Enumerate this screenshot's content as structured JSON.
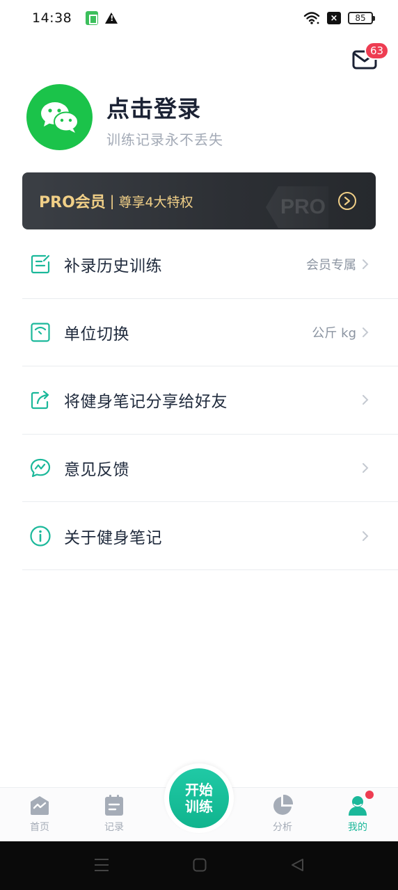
{
  "status_bar": {
    "time": "14:38",
    "battery": "85"
  },
  "mail": {
    "badge_count": "63"
  },
  "profile": {
    "title": "点击登录",
    "subtitle": "训练记录永不丢失"
  },
  "pro_banner": {
    "label": "PRO会员",
    "separator": "|",
    "perks": "尊享4大特权",
    "watermark": "PRO"
  },
  "menu": {
    "items": [
      {
        "label": "补录历史训练",
        "value": "会员专属",
        "icon": "edit-note-icon"
      },
      {
        "label": "单位切换",
        "value": "公斤 kg",
        "icon": "scale-icon"
      },
      {
        "label": "将健身笔记分享给好友",
        "value": "",
        "icon": "share-icon"
      },
      {
        "label": "意见反馈",
        "value": "",
        "icon": "feedback-chat-icon"
      },
      {
        "label": "关于健身笔记",
        "value": "",
        "icon": "info-icon"
      }
    ]
  },
  "tab_bar": {
    "home": "首页",
    "records": "记录",
    "start_line1": "开始",
    "start_line2": "训练",
    "analysis": "分析",
    "mine": "我的"
  },
  "colors": {
    "accent": "#1bb89a",
    "wechat_green": "#1bc34a",
    "pro_gold": "#f0cf87",
    "badge_red": "#ee3d52"
  }
}
